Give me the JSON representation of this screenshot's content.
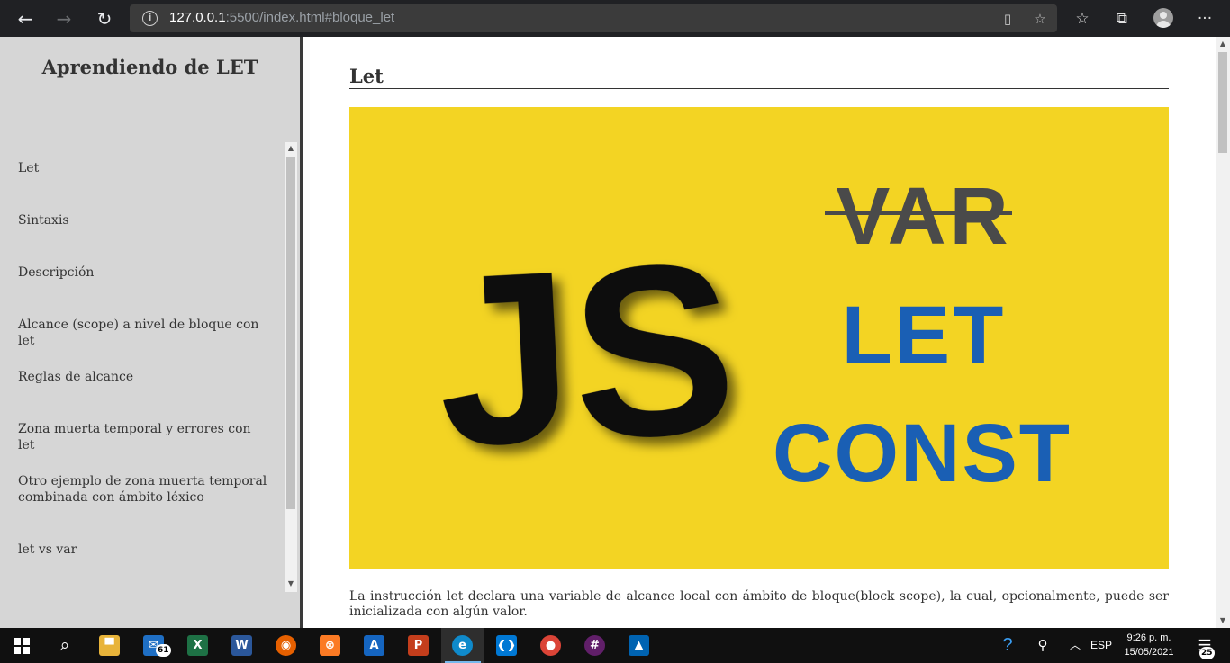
{
  "browser": {
    "url_host": "127.0.0.1",
    "url_rest": ":5500/index.html#bloque_let",
    "icons": [
      "back-arrow-icon",
      "forward-arrow-icon",
      "refresh-icon",
      "site-info-icon",
      "immersive-reader-icon",
      "add-favorite-icon",
      "favorites-icon",
      "collections-icon",
      "profile-icon",
      "more-menu-icon"
    ]
  },
  "sidebar": {
    "title": "Aprendiendo de LET",
    "items": [
      {
        "label": "Let"
      },
      {
        "label": "Sintaxis"
      },
      {
        "label": "Descripción"
      },
      {
        "label": "Alcance (scope) a nivel de bloque con let"
      },
      {
        "label": "Reglas de alcance"
      },
      {
        "label": "Zona muerta temporal y errores con let"
      },
      {
        "label": "Otro ejemplo de zona muerta temporal combinada con ámbito léxico"
      },
      {
        "label": "let vs var"
      }
    ]
  },
  "main": {
    "section_title": "Let",
    "hero": {
      "logo_text": "JS",
      "keywords": [
        "VAR",
        "LET",
        "CONST"
      ],
      "colors": {
        "background": "#f3d423",
        "logo": "#111111",
        "var": "#4a4a4a",
        "let_const": "#1a5fb4"
      }
    },
    "paragraph": "La instrucción let declara una variable de alcance local con ámbito de bloque(block scope), la cual, opcionalmente, puede ser inicializada con algún valor."
  },
  "taskbar": {
    "apps": [
      {
        "name": "file-explorer",
        "glyph": "▀",
        "color": "#e8b43a"
      },
      {
        "name": "mail",
        "glyph": "✉",
        "color": "#1f6fc4",
        "badge": "61"
      },
      {
        "name": "excel",
        "glyph": "X",
        "color": "#1e7145"
      },
      {
        "name": "word",
        "glyph": "W",
        "color": "#2b579a"
      },
      {
        "name": "firefox",
        "glyph": "◉",
        "color": "#e66000"
      },
      {
        "name": "xampp",
        "glyph": "⊗",
        "color": "#fb7a24"
      },
      {
        "name": "architect",
        "glyph": "A",
        "color": "#1565c0"
      },
      {
        "name": "powerpoint",
        "glyph": "P",
        "color": "#c43e1c"
      },
      {
        "name": "edge",
        "glyph": "e",
        "color": "#0f8acb",
        "active": true
      },
      {
        "name": "vscode",
        "glyph": "❰❱",
        "color": "#0078d4"
      },
      {
        "name": "chrome",
        "glyph": "●",
        "color": "#db4437"
      },
      {
        "name": "slack",
        "glyph": "#",
        "color": "#611f69"
      },
      {
        "name": "photos",
        "glyph": "▲",
        "color": "#0063b1"
      }
    ],
    "language": "ESP",
    "time": "9:26 p. m.",
    "date": "15/05/2021",
    "notifications": "25"
  }
}
